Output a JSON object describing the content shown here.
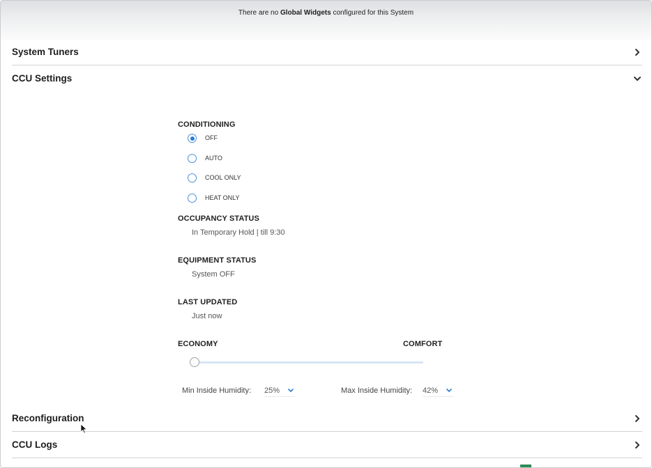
{
  "banner": {
    "prefix": "There are no ",
    "bold": "Global Widgets",
    "suffix": " configured for this System"
  },
  "sections": {
    "system_tuners": {
      "title": "System Tuners"
    },
    "ccu_settings": {
      "title": "CCU Settings"
    },
    "reconfiguration": {
      "title": "Reconfiguration"
    },
    "ccu_logs": {
      "title": "CCU Logs"
    }
  },
  "conditioning": {
    "label": "CONDITIONING",
    "selected": "OFF",
    "options": [
      {
        "label": "OFF",
        "checked": true
      },
      {
        "label": "AUTO",
        "checked": false
      },
      {
        "label": "COOL ONLY",
        "checked": false
      },
      {
        "label": "HEAT ONLY",
        "checked": false
      }
    ]
  },
  "occupancy": {
    "label": "OCCUPANCY STATUS",
    "value": "In Temporary Hold | till 9:30"
  },
  "equipment": {
    "label": "EQUIPMENT STATUS",
    "value": "System OFF"
  },
  "last_updated": {
    "label": "LAST UPDATED",
    "value": "Just now"
  },
  "slider": {
    "left_label": "ECONOMY",
    "right_label": "COMFORT",
    "position": 0
  },
  "humidity": {
    "min_label": "Min Inside Humidity:",
    "min_value": "25%",
    "max_label": "Max Inside Humidity:",
    "max_value": "42%"
  },
  "colors": {
    "accent": "#2a7ad2",
    "radio_border": "#4a90d9",
    "divider": "#cfd3d7"
  },
  "icons": {
    "collapsed": "chevron-right-icon",
    "expanded": "chevron-down-icon",
    "dropdown": "chevron-down-icon"
  }
}
